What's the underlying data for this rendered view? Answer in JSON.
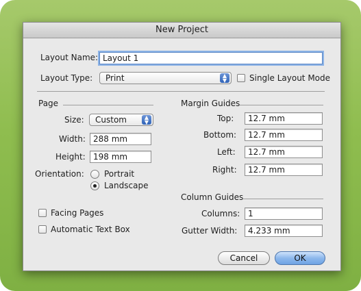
{
  "dialog": {
    "title": "New Project",
    "layout_name_label": "Layout Name:",
    "layout_name_value": "Layout 1",
    "layout_type_label": "Layout Type:",
    "layout_type_value": "Print",
    "single_layout_mode_label": "Single Layout Mode",
    "page": {
      "heading": "Page",
      "size_label": "Size:",
      "size_value": "Custom",
      "width_label": "Width:",
      "width_value": "288 mm",
      "height_label": "Height:",
      "height_value": "198 mm",
      "orientation_label": "Orientation:",
      "portrait_label": "Portrait",
      "landscape_label": "Landscape",
      "orientation_selected": "Landscape"
    },
    "margin_guides": {
      "heading": "Margin Guides",
      "top_label": "Top:",
      "top_value": "12.7 mm",
      "bottom_label": "Bottom:",
      "bottom_value": "12.7 mm",
      "left_label": "Left:",
      "left_value": "12.7 mm",
      "right_label": "Right:",
      "right_value": "12.7 mm"
    },
    "column_guides": {
      "heading": "Column Guides",
      "columns_label": "Columns:",
      "columns_value": "1",
      "gutter_label": "Gutter Width:",
      "gutter_value": "4.233 mm"
    },
    "facing_pages_label": "Facing Pages",
    "automatic_text_box_label": "Automatic Text Box",
    "cancel_label": "Cancel",
    "ok_label": "OK"
  }
}
